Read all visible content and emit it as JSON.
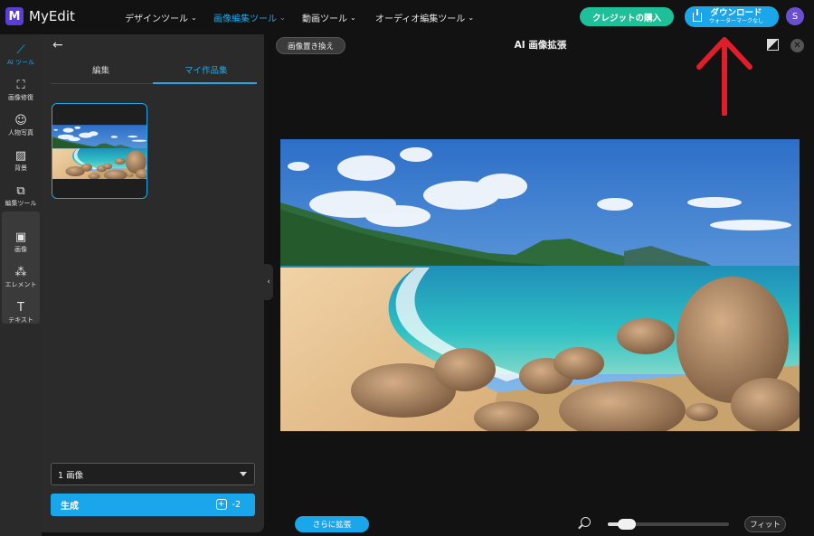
{
  "app": {
    "logo_letter": "M",
    "name": "MyEdit"
  },
  "nav": [
    {
      "label": "デザインツール",
      "active": false
    },
    {
      "label": "画像編集ツール",
      "active": true
    },
    {
      "label": "動画ツール",
      "active": false
    },
    {
      "label": "オーディオ編集ツール",
      "active": false
    }
  ],
  "header": {
    "credit_button": "クレジットの購入",
    "download_button": "ダウンロード",
    "download_sub": "ウォーターマークなし",
    "avatar_initial": "S"
  },
  "rail": {
    "items": [
      {
        "label": "AI ツール",
        "icon": "magic-wand-icon",
        "active": true
      },
      {
        "label": "画像修復",
        "icon": "image-repair-icon",
        "active": false
      },
      {
        "label": "人物写真",
        "icon": "portrait-icon",
        "active": false
      },
      {
        "label": "背景",
        "icon": "background-icon",
        "active": false
      },
      {
        "label": "編集ツール",
        "icon": "crop-icon",
        "active": false
      },
      {
        "label": "画像",
        "icon": "image-icon",
        "active": false
      },
      {
        "label": "エレメント",
        "icon": "elements-icon",
        "active": false
      },
      {
        "label": "テキスト",
        "icon": "text-icon",
        "active": false
      }
    ]
  },
  "panel": {
    "tabs": [
      {
        "label": "編集",
        "active": false
      },
      {
        "label": "マイ作品集",
        "active": true
      }
    ],
    "image_count_select": "1 画像",
    "generate_button": "生成",
    "generate_cost": "-2"
  },
  "canvas": {
    "replace_button": "画像置き換え",
    "title": "AI 画像拡張",
    "expand_button": "さらに拡張",
    "fit_button": "フィット",
    "zoom_level": 0.1
  },
  "colors": {
    "accent": "#1aa6ea",
    "credit": "#1fbf9a",
    "brand": "#5a3fd6",
    "annotation_arrow": "#e01e2b"
  }
}
